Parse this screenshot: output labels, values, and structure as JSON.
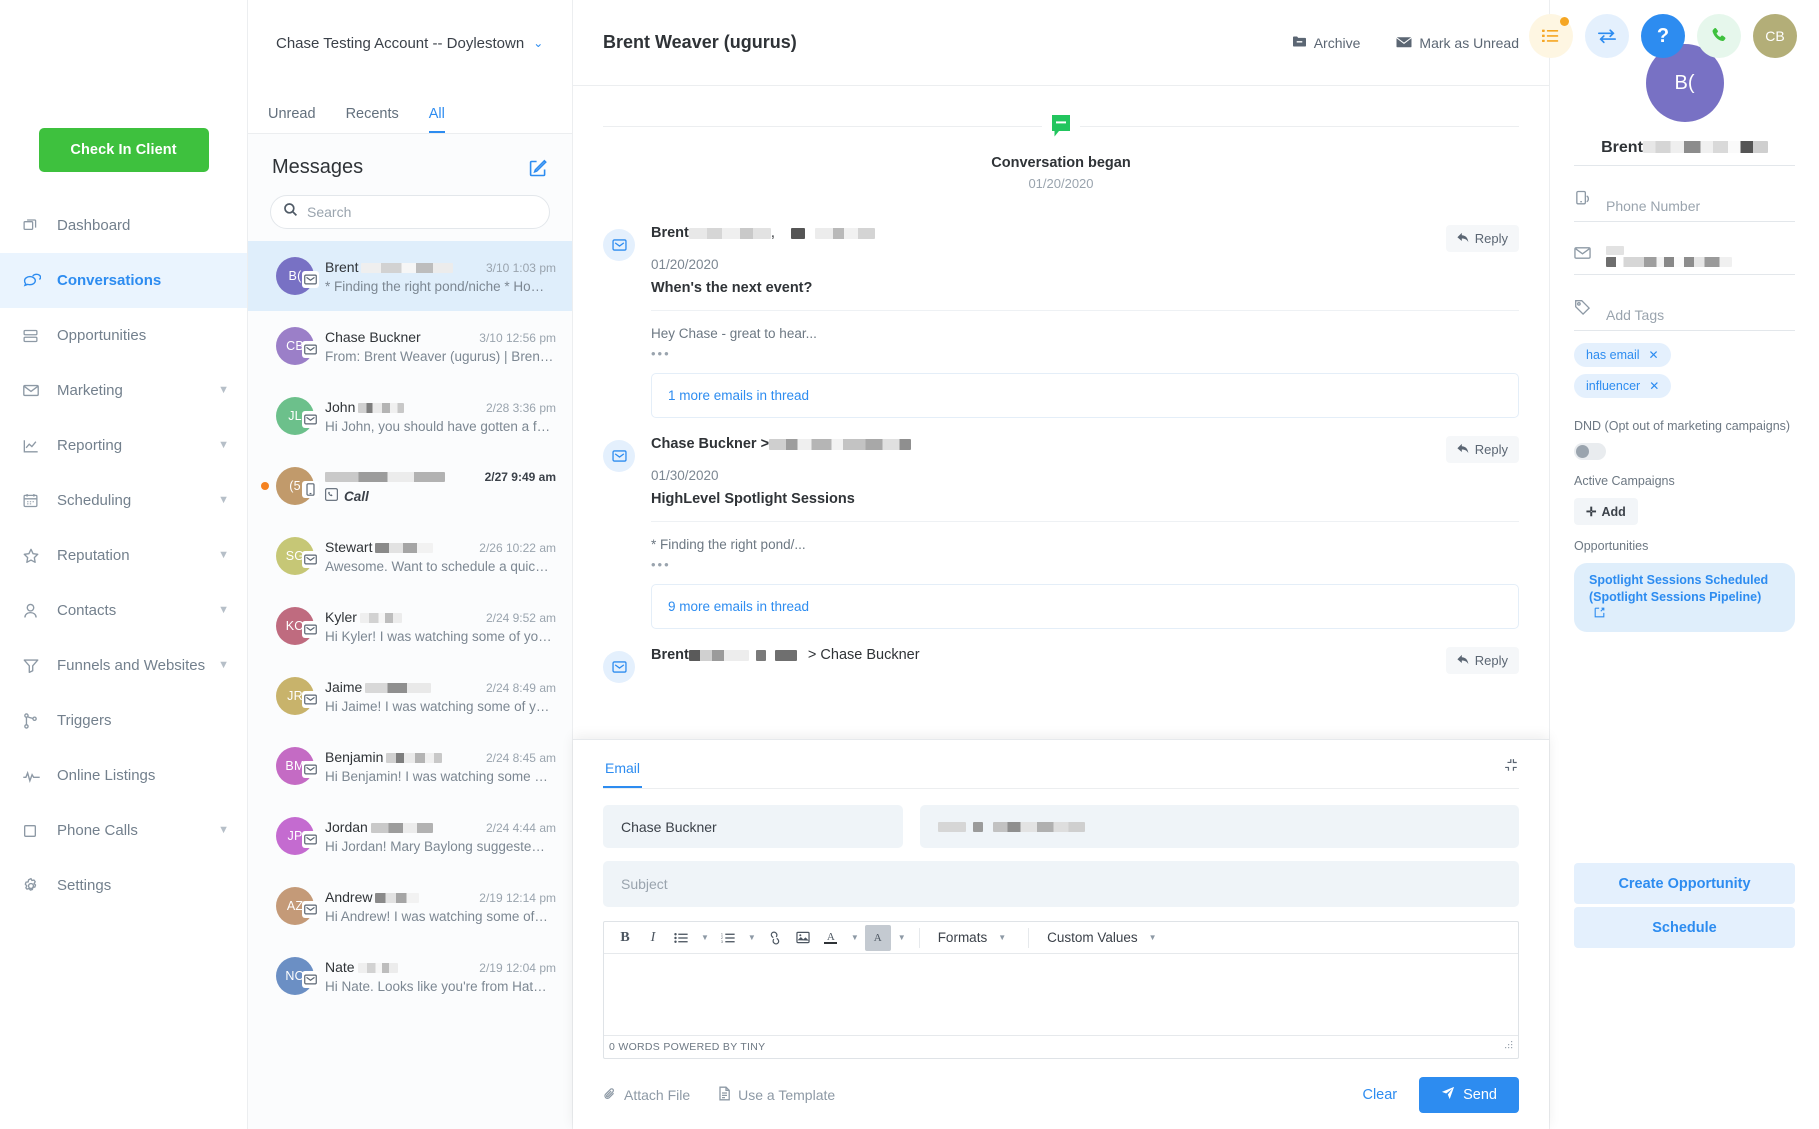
{
  "topbar": {
    "account_name": "Chase Testing Account -- Doylestown",
    "icons": [
      {
        "name": "tasks-icon",
        "glyph": "list"
      },
      {
        "name": "switch-account-icon",
        "glyph": "swap"
      },
      {
        "name": "help-icon",
        "glyph": "?"
      },
      {
        "name": "phone-icon",
        "glyph": "phone"
      },
      {
        "name": "user-avatar",
        "glyph": "CB"
      }
    ],
    "user_initials": "CB",
    "help_label": "?"
  },
  "sidebar": {
    "cta_label": "Check In Client",
    "items": [
      {
        "label": "Dashboard",
        "icon": "dashboard-icon",
        "chevron": false,
        "active": false
      },
      {
        "label": "Conversations",
        "icon": "chat-icon",
        "chevron": false,
        "active": true
      },
      {
        "label": "Opportunities",
        "icon": "stack-icon",
        "chevron": false,
        "active": false
      },
      {
        "label": "Marketing",
        "icon": "envelope-icon",
        "chevron": true,
        "active": false
      },
      {
        "label": "Reporting",
        "icon": "chart-icon",
        "chevron": true,
        "active": false
      },
      {
        "label": "Scheduling",
        "icon": "calendar-icon",
        "chevron": true,
        "active": false
      },
      {
        "label": "Reputation",
        "icon": "star-icon",
        "chevron": true,
        "active": false
      },
      {
        "label": "Contacts",
        "icon": "person-icon",
        "chevron": true,
        "active": false
      },
      {
        "label": "Funnels and Websites",
        "icon": "funnel-icon",
        "chevron": true,
        "active": false
      },
      {
        "label": "Triggers",
        "icon": "branch-icon",
        "chevron": false,
        "active": false
      },
      {
        "label": "Online Listings",
        "icon": "pulse-icon",
        "chevron": false,
        "active": false
      },
      {
        "label": "Phone Calls",
        "icon": "square-icon",
        "chevron": true,
        "active": false
      },
      {
        "label": "Settings",
        "icon": "gear-icon",
        "chevron": false,
        "active": false
      }
    ]
  },
  "message_panel": {
    "tabs": [
      {
        "label": "Unread",
        "active": false
      },
      {
        "label": "Recents",
        "active": false
      },
      {
        "label": "All",
        "active": true
      }
    ],
    "title": "Messages",
    "search_placeholder": "Search",
    "search_value": "",
    "rows": [
      {
        "initials": "B(",
        "color": "#7871c4",
        "name": "Brent",
        "name_redacted": true,
        "time": "3/10 1:03 pm",
        "preview": "* Finding the right pond/niche * Ho…",
        "channel": "email",
        "selected": true,
        "unread": false,
        "bold_time": false
      },
      {
        "initials": "CB",
        "color": "#9b7fc8",
        "name": "Chase Buckner",
        "name_redacted": false,
        "time": "3/10 12:56 pm",
        "preview": "From: Brent Weaver (ugurus) | Bren…",
        "channel": "email",
        "selected": false,
        "unread": false,
        "bold_time": false
      },
      {
        "initials": "JL",
        "color": "#6cc08b",
        "name": "John",
        "name_redacted": true,
        "time": "2/28 3:36 pm",
        "preview": "Hi John, you should have gotten a f…",
        "channel": "email",
        "selected": false,
        "unread": false,
        "bold_time": false
      },
      {
        "initials": "(5",
        "color": "#c19a6b",
        "name": "",
        "name_redacted": true,
        "time": "2/27 9:49 am",
        "preview": "Call",
        "channel": "phone",
        "selected": false,
        "unread": true,
        "bold_time": true
      },
      {
        "initials": "SG",
        "color": "#c6c776",
        "name": "Stewart",
        "name_redacted": true,
        "time": "2/26 10:22 am",
        "preview": "Awesome. Want to schedule a quic…",
        "channel": "email",
        "selected": false,
        "unread": false,
        "bold_time": false
      },
      {
        "initials": "KO",
        "color": "#bf6b7f",
        "name": "Kyler",
        "name_redacted": true,
        "time": "2/24 9:52 am",
        "preview": "Hi Kyler! I was watching some of yo…",
        "channel": "email",
        "selected": false,
        "unread": false,
        "bold_time": false
      },
      {
        "initials": "JR",
        "color": "#c8b36b",
        "name": "Jaime",
        "name_redacted": true,
        "time": "2/24 8:49 am",
        "preview": "Hi Jaime! I was watching some of y…",
        "channel": "email",
        "selected": false,
        "unread": false,
        "bold_time": false
      },
      {
        "initials": "BM",
        "color": "#c46bc4",
        "name": "Benjamin",
        "name_redacted": true,
        "time": "2/24 8:45 am",
        "preview": "Hi Benjamin! I was watching some …",
        "channel": "email",
        "selected": false,
        "unread": false,
        "bold_time": false
      },
      {
        "initials": "JP",
        "color": "#c46bd0",
        "name": "Jordan",
        "name_redacted": true,
        "time": "2/24 4:44 am",
        "preview": "Hi Jordan! Mary Baylong suggeste…",
        "channel": "email",
        "selected": false,
        "unread": false,
        "bold_time": false
      },
      {
        "initials": "AZ",
        "color": "#c49a78",
        "name": "Andrew",
        "name_redacted": true,
        "time": "2/19 12:14 pm",
        "preview": "Hi Andrew! I was watching some of…",
        "channel": "email",
        "selected": false,
        "unread": false,
        "bold_time": false
      },
      {
        "initials": "NO",
        "color": "#6b8fc4",
        "name": "Nate",
        "name_redacted": true,
        "time": "2/19 12:04 pm",
        "preview": "Hi Nate. Looks like you're from Hat…",
        "channel": "email",
        "selected": false,
        "unread": false,
        "bold_time": false
      }
    ]
  },
  "conversation": {
    "title": "Brent Weaver (ugurus)",
    "archive_label": "Archive",
    "mark_unread_label": "Mark as Unread",
    "began_label": "Conversation began",
    "began_date": "01/20/2020",
    "reply_label": "Reply",
    "emails": [
      {
        "from_name": "Brent",
        "from_redacted": true,
        "date": "01/20/2020",
        "subject": "When's the next event?",
        "snippet": "Hey Chase - great to hear...",
        "more_label": "1 more emails in thread"
      },
      {
        "from_name": "Chase Buckner >",
        "from_redacted": true,
        "date": "01/30/2020",
        "subject": "HighLevel Spotlight Sessions",
        "snippet": "* Finding the right pond/...",
        "more_label": "9 more emails in thread"
      },
      {
        "from_name": "Brent",
        "from_suffix": "> Chase Buckner",
        "from_redacted": true,
        "date": "",
        "subject": "",
        "snippet": "",
        "more_label": ""
      }
    ]
  },
  "composer": {
    "tab_label": "Email",
    "to_value": "Chase Buckner",
    "cc_value": "",
    "subject_placeholder": "Subject",
    "subject_value": "",
    "body_value": "",
    "toolbar": {
      "bold": "B",
      "italic": "I",
      "bullet_list": "bullet-list",
      "numbered_list": "numbered-list",
      "link": "link",
      "image": "image",
      "text_color": "A",
      "background_color": "A",
      "formats_label": "Formats",
      "custom_values_label": "Custom Values"
    },
    "status_text": "0 WORDS POWERED BY TINY",
    "attach_label": "Attach File",
    "template_label": "Use a Template",
    "clear_label": "Clear",
    "send_label": "Send"
  },
  "contact": {
    "initials": "B(",
    "avatar_color": "#7871c4",
    "name": "Brent",
    "name_redacted": true,
    "phone_placeholder": "Phone Number",
    "phone_value": "",
    "email_value": "",
    "email_redacted": true,
    "tags_placeholder": "Add Tags",
    "tags": [
      "has email",
      "influencer"
    ],
    "dnd_label": "DND (Opt out of marketing campaigns)",
    "dnd_enabled": false,
    "campaigns_label": "Active Campaigns",
    "add_label": "Add",
    "opportunities_label": "Opportunities",
    "opportunity_chip": "Spotlight Sessions Scheduled (Spotlight Sessions Pipeline)",
    "create_opportunity_label": "Create Opportunity",
    "schedule_label": "Schedule"
  }
}
